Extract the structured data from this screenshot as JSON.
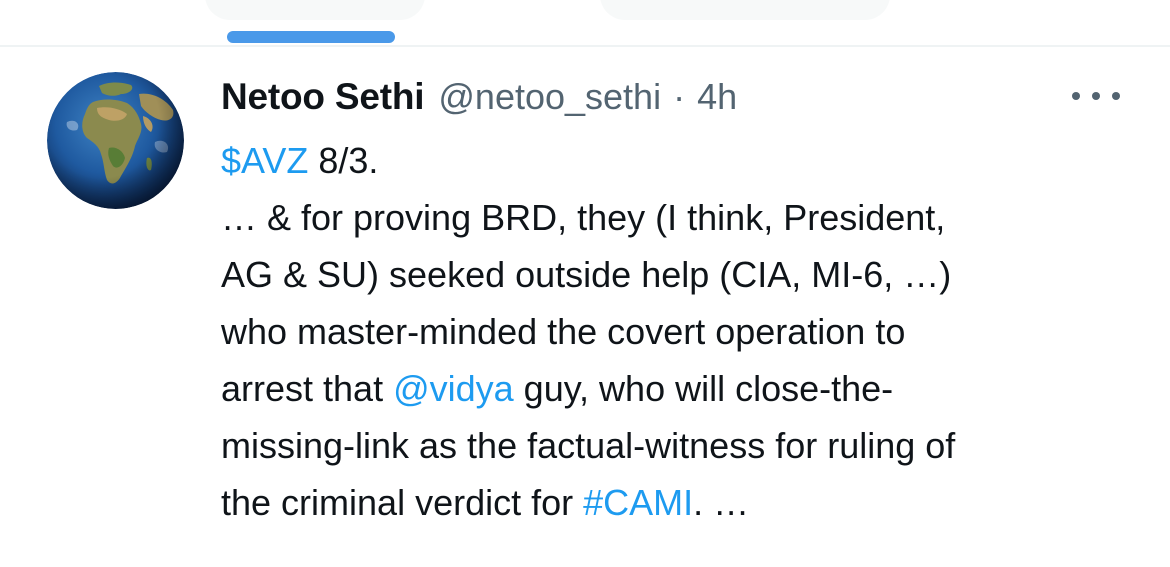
{
  "colors": {
    "accent": "#1d9bf0",
    "tab_indicator": "#4a99e9",
    "secondary_text": "#536471",
    "primary_text": "#0f1419",
    "divider": "#eff3f4"
  },
  "tweet": {
    "author": {
      "display_name": "Netoo Sethi",
      "handle": "@netoo_sethi",
      "avatar_icon": "earth-globe-icon"
    },
    "separator": "·",
    "time": "4h",
    "more_icon": "more-options-icon",
    "cashtag": "$AVZ",
    "line1_rest": " 8/3.",
    "line2": "… & for proving BRD, they (I think, President,",
    "line3": "AG & SU) seeked outside help (CIA, MI-6, …)",
    "line4": "who master-minded the covert operation to",
    "line5_before": "arrest that ",
    "mention": "@vidya",
    "line5_after": " guy, who will close-the-",
    "line6": "missing-link as the factual-witness for ruling of",
    "line7_before": "the criminal verdict for ",
    "hashtag": "#CAMI",
    "line7_after": ". …"
  }
}
